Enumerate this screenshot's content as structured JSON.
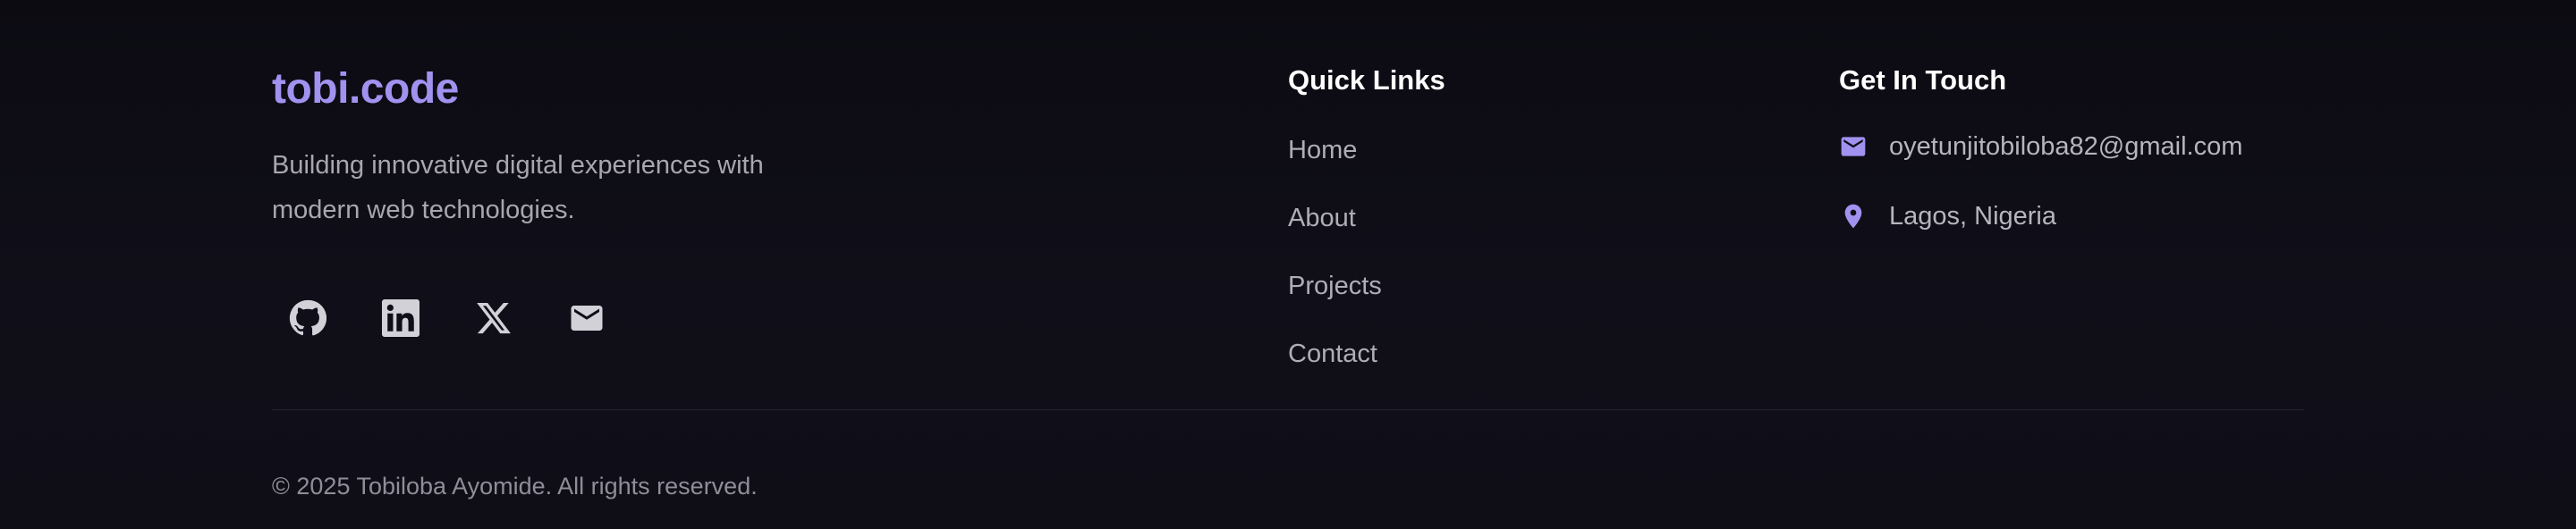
{
  "brand": {
    "title": "tobi.code",
    "description_line1": "Building innovative digital experiences with",
    "description_line2": "modern web technologies."
  },
  "social": [
    {
      "icon": "github-icon"
    },
    {
      "icon": "linkedin-icon"
    },
    {
      "icon": "x-icon"
    },
    {
      "icon": "mail-icon"
    }
  ],
  "quick_links": {
    "heading": "Quick Links",
    "items": [
      "Home",
      "About",
      "Projects",
      "Contact"
    ]
  },
  "contact": {
    "heading": "Get In Touch",
    "email": "oyetunjitobiloba82@gmail.com",
    "location": "Lagos, Nigeria"
  },
  "footer": {
    "copyright": "© 2025 Tobiloba Ayomide. All rights reserved."
  },
  "colors": {
    "accent": "#a192f0",
    "background": "#0d0c14",
    "heading": "#ffffff",
    "muted_text": "#a7a6b1"
  }
}
